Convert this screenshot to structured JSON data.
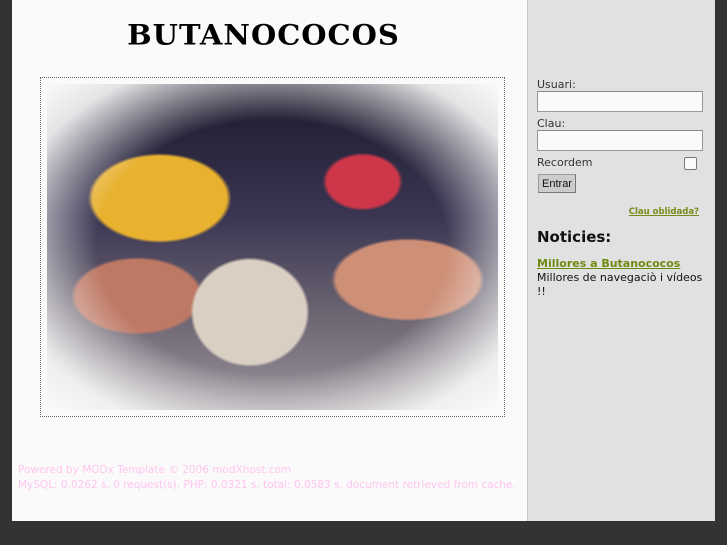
{
  "site": {
    "logo_text": "BUTANOCOCOS"
  },
  "login": {
    "username_label": "Usuari:",
    "username_value": "",
    "password_label": "Clau:",
    "password_value": "",
    "remember_label": "Recordem",
    "remember_checked": false,
    "submit_label": "Entrar",
    "forgot_label": "Clau oblidada?"
  },
  "news": {
    "heading": "Noticies:",
    "items": [
      {
        "title": "Millores a Butanococos",
        "text": "Millores de navegaciò i vídeos !!"
      }
    ]
  },
  "footer": {
    "powered": "Powered by MODx  Template © 2006 modXhost.com",
    "stats": "MySQL: 0.0262 s, 0 request(s), PHP: 0.0321 s, total: 0.0583 s, document retrieved from cache."
  },
  "colors": {
    "background": "#333333",
    "sidebar": "#e1e1e1",
    "link": "#6f8a10",
    "footer_text": "#ffc6f0"
  }
}
